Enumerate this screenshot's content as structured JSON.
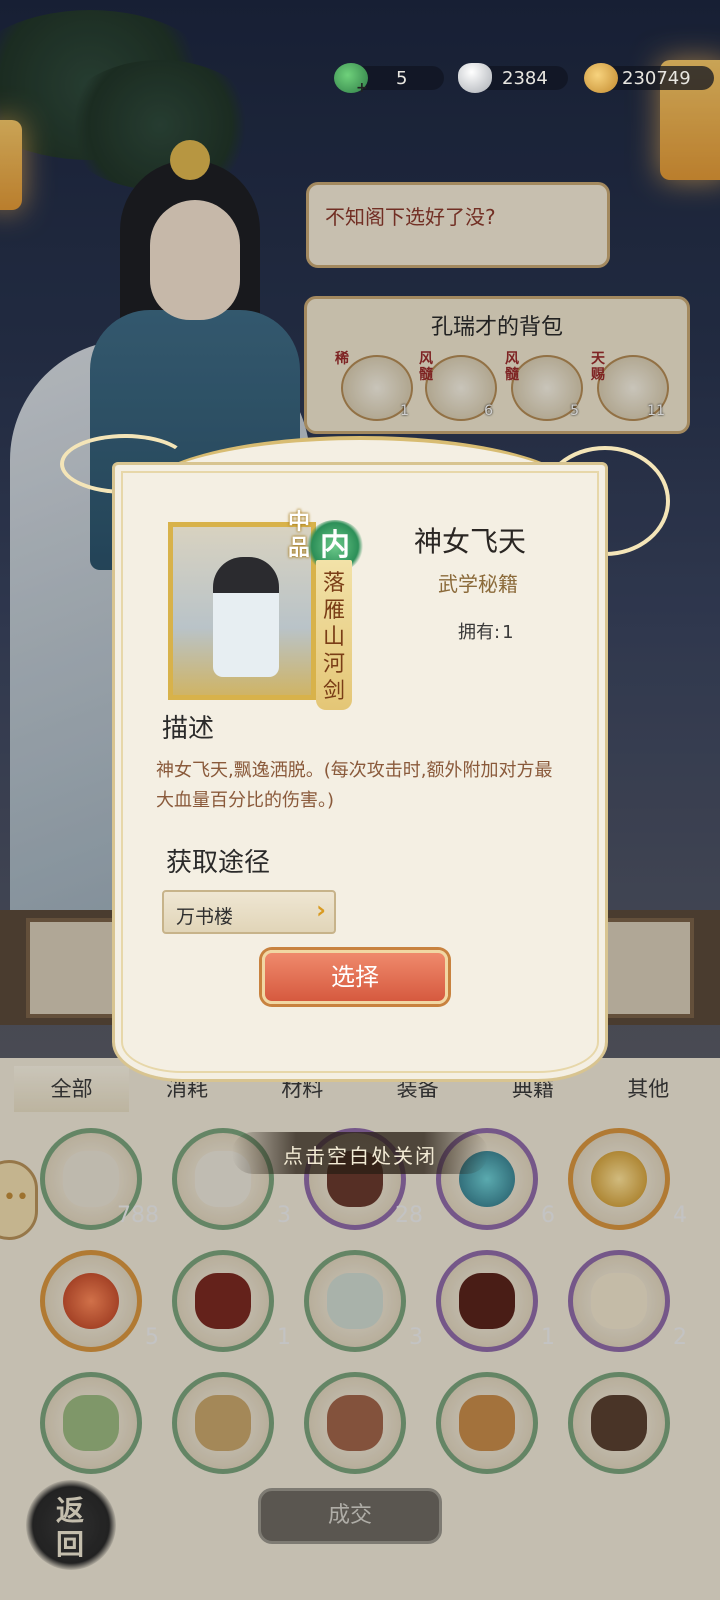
{
  "currency": {
    "jade": "5",
    "silver": "2384",
    "copper": "230749"
  },
  "npc": {
    "speech": "不知阁下选好了没?"
  },
  "bag": {
    "title": "孔瑞才的背包",
    "items": [
      {
        "tag": "稀",
        "count": "1"
      },
      {
        "tag": "风髓",
        "count": "6"
      },
      {
        "tag": "风髓",
        "count": "5"
      },
      {
        "tag": "天赐",
        "count": "11"
      }
    ]
  },
  "modal": {
    "grade": "中品",
    "category_glyph": "内",
    "card_ribbon": "落雁山河剑",
    "name": "神女飞天",
    "type": "武学秘籍",
    "owned_label": "拥有:",
    "owned_value": "1",
    "desc_title": "描述",
    "description": "神女飞天,飘逸洒脱。(每次攻击时,额外附加对方最大血量百分比的伤害。)",
    "source_title": "获取途径",
    "source_label": "万书楼",
    "select_label": "选择"
  },
  "close_hint": "点击空白处关闭",
  "tabs": [
    "全部",
    "消耗",
    "材料",
    "装备",
    "典籍",
    "其他"
  ],
  "inventory": {
    "row1": [
      "788",
      "3",
      "28",
      "6",
      "4"
    ],
    "row2": [
      "5",
      "1",
      "3",
      "1",
      "2"
    ]
  },
  "footer": {
    "back_label": "返回",
    "deal_label": "成交"
  },
  "colors": {
    "accent_red": "#d65a3f",
    "gold_border": "#d8b24a",
    "desc_text": "#8a5a3b"
  }
}
